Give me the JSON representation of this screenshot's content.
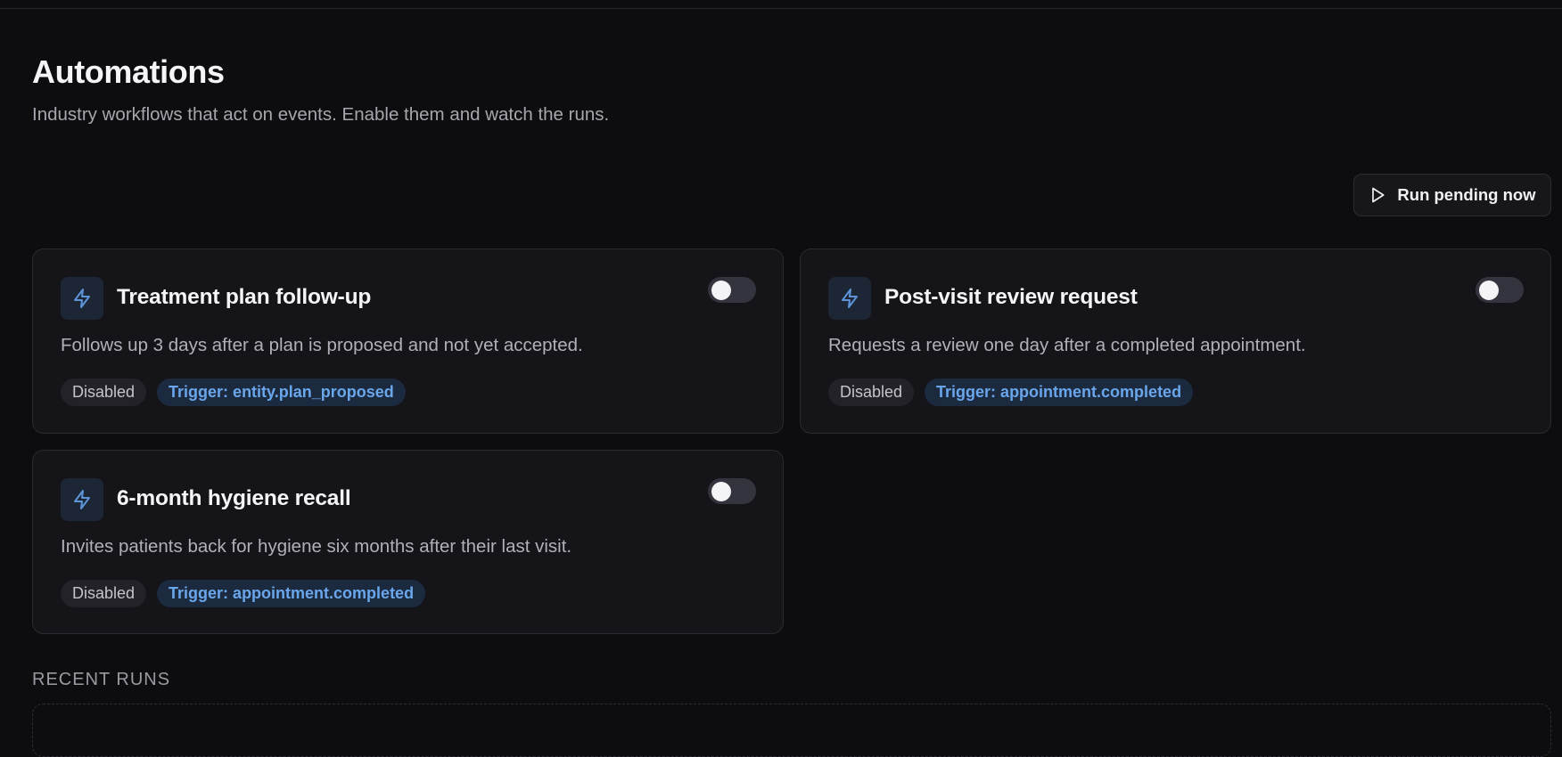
{
  "header": {
    "title": "Automations",
    "subtitle": "Industry workflows that act on events. Enable them and watch the runs."
  },
  "toolbar": {
    "run_label": "Run pending now"
  },
  "automations": [
    {
      "title": "Treatment plan follow-up",
      "description": "Follows up 3 days after a plan is proposed and not yet accepted.",
      "status": "Disabled",
      "trigger": "Trigger: entity.plan_proposed",
      "enabled": false
    },
    {
      "title": "Post-visit review request",
      "description": "Requests a review one day after a completed appointment.",
      "status": "Disabled",
      "trigger": "Trigger: appointment.completed",
      "enabled": false
    },
    {
      "title": "6-month hygiene recall",
      "description": "Invites patients back for hygiene six months after their last visit.",
      "status": "Disabled",
      "trigger": "Trigger: appointment.completed",
      "enabled": false
    }
  ],
  "recent_runs": {
    "heading": "RECENT RUNS"
  },
  "icons": {
    "card_icon": "bolt-icon",
    "run_icon": "play-icon"
  },
  "colors": {
    "background": "#0d0d10",
    "card": "#151519",
    "accent": "#6aa6ea",
    "toggle_off": "#33343d"
  }
}
